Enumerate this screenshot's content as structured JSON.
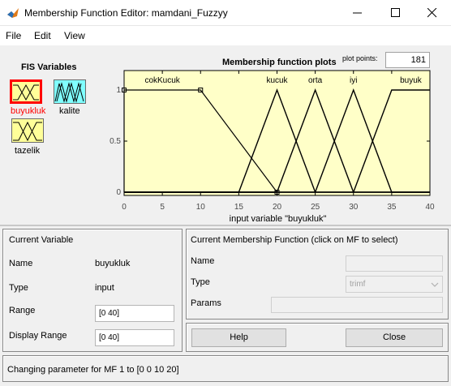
{
  "window": {
    "title": "Membership Function Editor: mamdani_Fuzzyy"
  },
  "menu": [
    "File",
    "Edit",
    "View"
  ],
  "fis_variables": {
    "heading": "FIS Variables",
    "inputs": [
      {
        "label": "buyukluk",
        "selected": true,
        "color": "#ffff99",
        "icon": "membership-function-icon"
      },
      {
        "label": "tazelik",
        "selected": false,
        "color": "#ffff99",
        "icon": "membership-function-icon"
      }
    ],
    "outputs": [
      {
        "label": "kalite",
        "selected": false,
        "color": "#80ffff",
        "icon": "membership-function-icon"
      }
    ],
    "selected_label_color": "#ff0000"
  },
  "plot": {
    "title": "Membership function plots",
    "plot_points_label": "plot points:",
    "plot_points_value": "181"
  },
  "chart_data": {
    "type": "line",
    "title": "Membership function plots",
    "xlabel": "input variable \"buyukluk\"",
    "ylabel": "",
    "xlim": [
      0,
      40
    ],
    "ylim": [
      0,
      1
    ],
    "x_ticks": [
      "0",
      "5",
      "10",
      "15",
      "20",
      "25",
      "30",
      "35",
      "40"
    ],
    "y_ticks": [
      "0",
      "0.5",
      "1"
    ],
    "background": "#ffffc8",
    "series": [
      {
        "name": "cokKucuk",
        "points": [
          [
            0,
            0
          ],
          [
            0,
            1
          ],
          [
            10,
            1
          ],
          [
            20,
            0
          ]
        ],
        "color": "#000000",
        "selected": true
      },
      {
        "name": "kucuk",
        "points": [
          [
            0,
            0
          ],
          [
            15,
            0
          ],
          [
            20,
            1
          ],
          [
            25,
            0
          ],
          [
            40,
            0
          ]
        ],
        "color": "#000000"
      },
      {
        "name": "orta",
        "points": [
          [
            0,
            0
          ],
          [
            20,
            0
          ],
          [
            25,
            1
          ],
          [
            30,
            0
          ],
          [
            40,
            0
          ]
        ],
        "color": "#000000"
      },
      {
        "name": "iyi",
        "points": [
          [
            0,
            0
          ],
          [
            25,
            0
          ],
          [
            30,
            1
          ],
          [
            35,
            0
          ],
          [
            40,
            0
          ]
        ],
        "color": "#000000"
      },
      {
        "name": "buyuk",
        "points": [
          [
            0,
            0
          ],
          [
            30,
            0
          ],
          [
            35,
            1
          ],
          [
            40,
            1
          ]
        ],
        "color": "#000000"
      }
    ],
    "labels": [
      {
        "text": "cokKucuk",
        "x": 5
      },
      {
        "text": "kucuk",
        "x": 20
      },
      {
        "text": "orta",
        "x": 25
      },
      {
        "text": "iyi",
        "x": 30
      },
      {
        "text": "buyuk",
        "x": 37.5
      }
    ]
  },
  "current_variable": {
    "heading": "Current Variable",
    "name_label": "Name",
    "name_value": "buyukluk",
    "type_label": "Type",
    "type_value": "input",
    "range_label": "Range",
    "range_value": "[0 40]",
    "display_range_label": "Display Range",
    "display_range_value": "[0 40]"
  },
  "current_mf": {
    "heading": "Current Membership Function (click on MF to select)",
    "name_label": "Name",
    "name_value": "",
    "type_label": "Type",
    "type_value": "trimf",
    "params_label": "Params",
    "params_value": ""
  },
  "buttons": {
    "help": "Help",
    "close": "Close"
  },
  "status": "Changing parameter for MF 1 to  [0 0 10 20]"
}
